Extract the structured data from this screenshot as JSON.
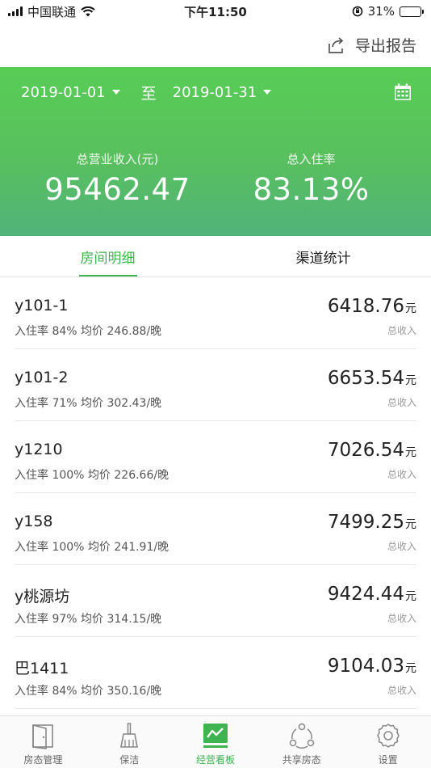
{
  "status_bar": {
    "carrier": "中国联通",
    "time": "下午11:50",
    "battery": "31%",
    "battery_level": 0.31
  },
  "nav": {
    "export_label": "导出报告"
  },
  "date_range": {
    "start": "2019-01-01",
    "separator": "至",
    "end": "2019-01-31"
  },
  "stats": {
    "revenue_label": "总营业收入(元)",
    "revenue_value": "95462.47",
    "occupancy_label": "总入住率",
    "occupancy_value": "83.13%"
  },
  "tabs": [
    {
      "label": "房间明细",
      "active": true
    },
    {
      "label": "渠道统计",
      "active": false
    }
  ],
  "rooms": [
    {
      "name": "y101-1",
      "meta": "入住率 84% 均价 246.88/晚",
      "amount": "6418.76",
      "unit": "元",
      "sub": "总收入"
    },
    {
      "name": "y101-2",
      "meta": "入住率 71% 均价 302.43/晚",
      "amount": "6653.54",
      "unit": "元",
      "sub": "总收入"
    },
    {
      "name": "y1210",
      "meta": "入住率 100% 均价 226.66/晚",
      "amount": "7026.54",
      "unit": "元",
      "sub": "总收入"
    },
    {
      "name": "y158",
      "meta": "入住率 100% 均价 241.91/晚",
      "amount": "7499.25",
      "unit": "元",
      "sub": "总收入"
    },
    {
      "name": "y桃源坊",
      "meta": "入住率 97% 均价 314.15/晚",
      "amount": "9424.44",
      "unit": "元",
      "sub": "总收入"
    },
    {
      "name": "巴1411",
      "meta": "入住率 84% 均价 350.16/晚",
      "amount": "9104.03",
      "unit": "元",
      "sub": "总收入"
    }
  ],
  "tabbar": [
    {
      "label": "房态管理",
      "icon": "door-icon",
      "active": false
    },
    {
      "label": "保洁",
      "icon": "broom-icon",
      "active": false
    },
    {
      "label": "经营看板",
      "icon": "chart-board-icon",
      "active": true
    },
    {
      "label": "共享房态",
      "icon": "share-icon",
      "active": false
    },
    {
      "label": "设置",
      "icon": "gear-icon",
      "active": false
    }
  ],
  "colors": {
    "accent": "#3fb34f",
    "hero_top": "#58cd56",
    "hero_bottom": "#52b27b"
  }
}
